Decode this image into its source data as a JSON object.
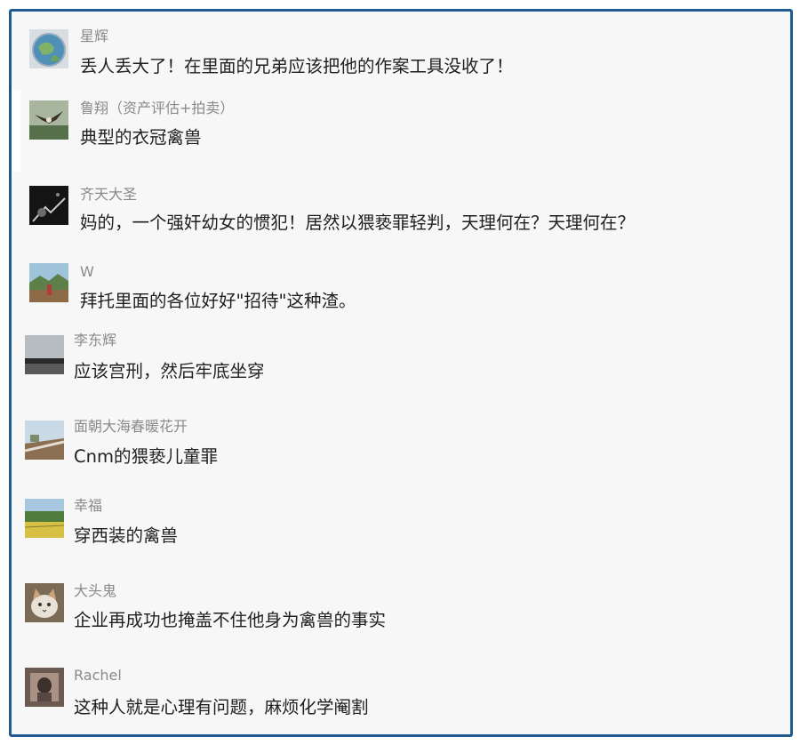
{
  "comments": [
    {
      "name": "星辉",
      "text": "丢人丢大了！在里面的兄弟应该把他的作案工具没收了！",
      "avatar_icon": "globe-avatar-icon"
    },
    {
      "name": "鲁翔（资产评估+拍卖）",
      "text": "典型的衣冠禽兽",
      "avatar_icon": "eagle-avatar-icon"
    },
    {
      "name": "齐天大圣",
      "text": "妈的，一个强奸幼女的惯犯！居然以猥亵罪轻判，天理何在？天理何在？",
      "avatar_icon": "dark-scene-avatar-icon"
    },
    {
      "name": "W",
      "text": "拜托里面的各位好好\"招待\"这种渣。",
      "avatar_icon": "landscape-avatar-icon"
    },
    {
      "name": "李东辉",
      "text": "应该宫刑，然后牢底坐穿",
      "avatar_icon": "gray-sky-avatar-icon"
    },
    {
      "name": "面朝大海春暖花开",
      "text": "Cnm的猥亵儿童罪",
      "avatar_icon": "road-avatar-icon"
    },
    {
      "name": "幸福",
      "text": "穿西装的禽兽",
      "avatar_icon": "field-avatar-icon"
    },
    {
      "name": "大头鬼",
      "text": "企业再成功也掩盖不住他身为禽兽的事实",
      "avatar_icon": "cat-avatar-icon"
    },
    {
      "name": "Rachel",
      "text": "这种人就是心理有问题，麻烦化学阉割",
      "avatar_icon": "photo-avatar-icon"
    }
  ],
  "colors": {
    "frame_border": "#1f5b8f",
    "background": "#f7f7f7",
    "name_text": "#8a8a8a",
    "body_text": "#1f1f1f"
  }
}
